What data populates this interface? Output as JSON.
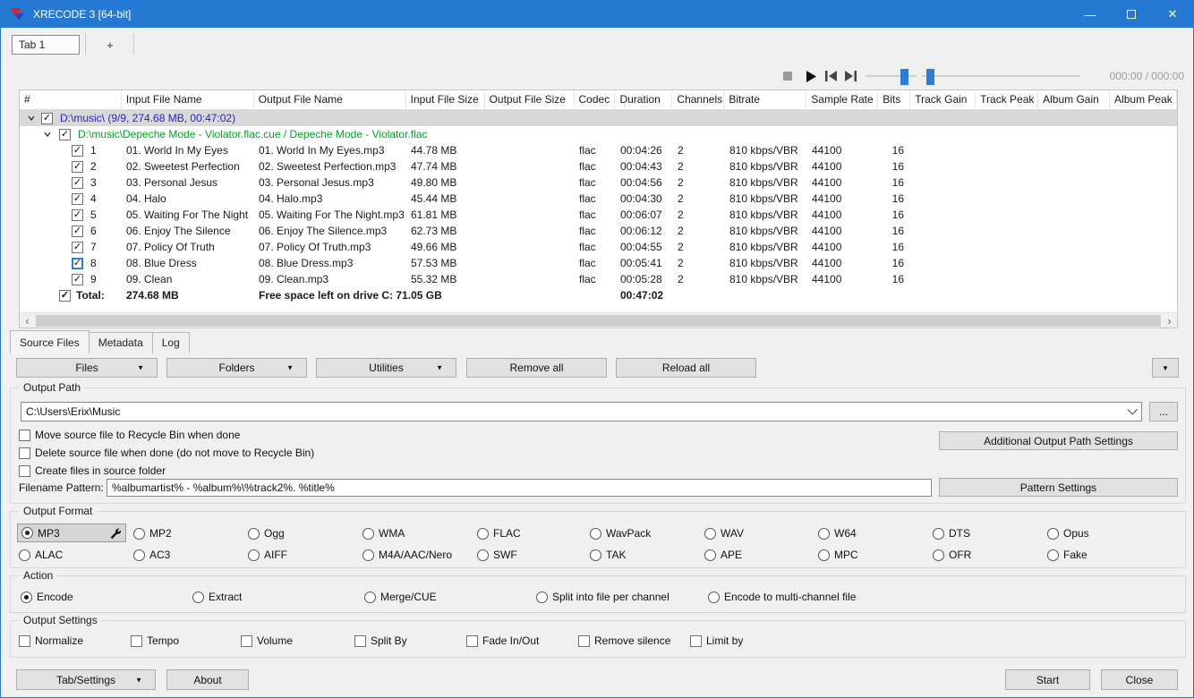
{
  "window": {
    "title": "XRECODE 3 [64-bit]",
    "minimize_glyph": "—",
    "close_glyph": "✕"
  },
  "tabs": {
    "tab1": "Tab 1",
    "add": "+"
  },
  "player": {
    "time": "000:00 / 000:00"
  },
  "scroll": {
    "left": "‹",
    "right": "›"
  },
  "icons": {
    "dropdown": "▼",
    "browse": "..."
  },
  "table": {
    "columns": [
      "#",
      "Input File Name",
      "Output File Name",
      "Input File Size",
      "Output File Size",
      "Codec",
      "Duration",
      "Channels",
      "Bitrate",
      "Sample Rate",
      "Bits",
      "Track Gain",
      "Track Peak",
      "Album Gain",
      "Album Peak"
    ],
    "group1": "D:\\music\\ (9/9, 274.68 MB, 00:47:02)",
    "group2": "D:\\music\\Depeche Mode - Violator.flac.cue / Depeche Mode - Violator.flac",
    "rows": [
      {
        "num": "1",
        "input": "01. World In My Eyes",
        "output": "01. World In My Eyes.mp3",
        "size": "44.78 MB",
        "codec": "flac",
        "duration": "00:04:26",
        "channels": "2",
        "bitrate": "810 kbps/VBR",
        "samplerate": "44100",
        "bits": "16"
      },
      {
        "num": "2",
        "input": "02. Sweetest Perfection",
        "output": "02. Sweetest Perfection.mp3",
        "size": "47.74 MB",
        "codec": "flac",
        "duration": "00:04:43",
        "channels": "2",
        "bitrate": "810 kbps/VBR",
        "samplerate": "44100",
        "bits": "16"
      },
      {
        "num": "3",
        "input": "03. Personal Jesus",
        "output": "03. Personal Jesus.mp3",
        "size": "49.80 MB",
        "codec": "flac",
        "duration": "00:04:56",
        "channels": "2",
        "bitrate": "810 kbps/VBR",
        "samplerate": "44100",
        "bits": "16"
      },
      {
        "num": "4",
        "input": "04. Halo",
        "output": "04. Halo.mp3",
        "size": "45.44 MB",
        "codec": "flac",
        "duration": "00:04:30",
        "channels": "2",
        "bitrate": "810 kbps/VBR",
        "samplerate": "44100",
        "bits": "16"
      },
      {
        "num": "5",
        "input": "05. Waiting For The Night",
        "output": "05. Waiting For The Night.mp3",
        "size": "61.81 MB",
        "codec": "flac",
        "duration": "00:06:07",
        "channels": "2",
        "bitrate": "810 kbps/VBR",
        "samplerate": "44100",
        "bits": "16"
      },
      {
        "num": "6",
        "input": "06. Enjoy The Silence",
        "output": "06. Enjoy The Silence.mp3",
        "size": "62.73 MB",
        "codec": "flac",
        "duration": "00:06:12",
        "channels": "2",
        "bitrate": "810 kbps/VBR",
        "samplerate": "44100",
        "bits": "16"
      },
      {
        "num": "7",
        "input": "07. Policy Of Truth",
        "output": "07. Policy Of Truth.mp3",
        "size": "49.66 MB",
        "codec": "flac",
        "duration": "00:04:55",
        "channels": "2",
        "bitrate": "810 kbps/VBR",
        "samplerate": "44100",
        "bits": "16"
      },
      {
        "num": "8",
        "input": "08. Blue Dress",
        "output": "08. Blue Dress.mp3",
        "size": "57.53 MB",
        "codec": "flac",
        "duration": "00:05:41",
        "channels": "2",
        "bitrate": "810 kbps/VBR",
        "samplerate": "44100",
        "bits": "16"
      },
      {
        "num": "9",
        "input": "09. Clean",
        "output": "09. Clean.mp3",
        "size": "55.32 MB",
        "codec": "flac",
        "duration": "00:05:28",
        "channels": "2",
        "bitrate": "810 kbps/VBR",
        "samplerate": "44100",
        "bits": "16"
      }
    ],
    "total": {
      "label": "Total:",
      "size": "274.68 MB",
      "freespace": "Free space left on drive C: 71.05 GB",
      "duration": "00:47:02"
    }
  },
  "view_tabs": {
    "source": "Source Files",
    "metadata": "Metadata",
    "log": "Log"
  },
  "toolbar": {
    "files": "Files",
    "folders": "Folders",
    "utilities": "Utilities",
    "remove_all": "Remove all",
    "reload_all": "Reload all"
  },
  "output_path": {
    "label": "Output Path",
    "value": "C:\\Users\\Erix\\Music",
    "additional_button": "Additional Output Path Settings",
    "checkboxes": [
      "Move source file to Recycle Bin when done",
      "Delete source file when done (do not move to Recycle Bin)",
      "Create files in source folder"
    ],
    "pattern_label": "Filename Pattern:",
    "pattern_value": "%albumartist% - %album%\\%track2%. %title%",
    "pattern_button": "Pattern Settings"
  },
  "output_format": {
    "label": "Output Format",
    "selected": "MP3",
    "row1": [
      "MP3",
      "MP2",
      "Ogg",
      "WMA",
      "FLAC",
      "WavPack",
      "WAV",
      "W64",
      "DTS",
      "Opus"
    ],
    "row2": [
      "ALAC",
      "AC3",
      "AIFF",
      "M4A/AAC/Nero",
      "SWF",
      "TAK",
      "APE",
      "MPC",
      "OFR",
      "Fake"
    ]
  },
  "action": {
    "label": "Action",
    "selected": "Encode",
    "options": [
      "Encode",
      "Extract",
      "Merge/CUE",
      "Split into file per channel",
      "Encode to multi-channel file"
    ]
  },
  "output_settings": {
    "label": "Output Settings",
    "options": [
      "Normalize",
      "Tempo",
      "Volume",
      "Split By",
      "Fade In/Out",
      "Remove silence",
      "Limit by"
    ]
  },
  "bottom": {
    "tab_settings": "Tab/Settings",
    "about": "About",
    "start": "Start",
    "close": "Close"
  },
  "colors": {
    "titlebar": "#2579d2",
    "accent": "#2d7dd2",
    "group1_text": "#2323cc",
    "group2_text": "#00a222"
  }
}
